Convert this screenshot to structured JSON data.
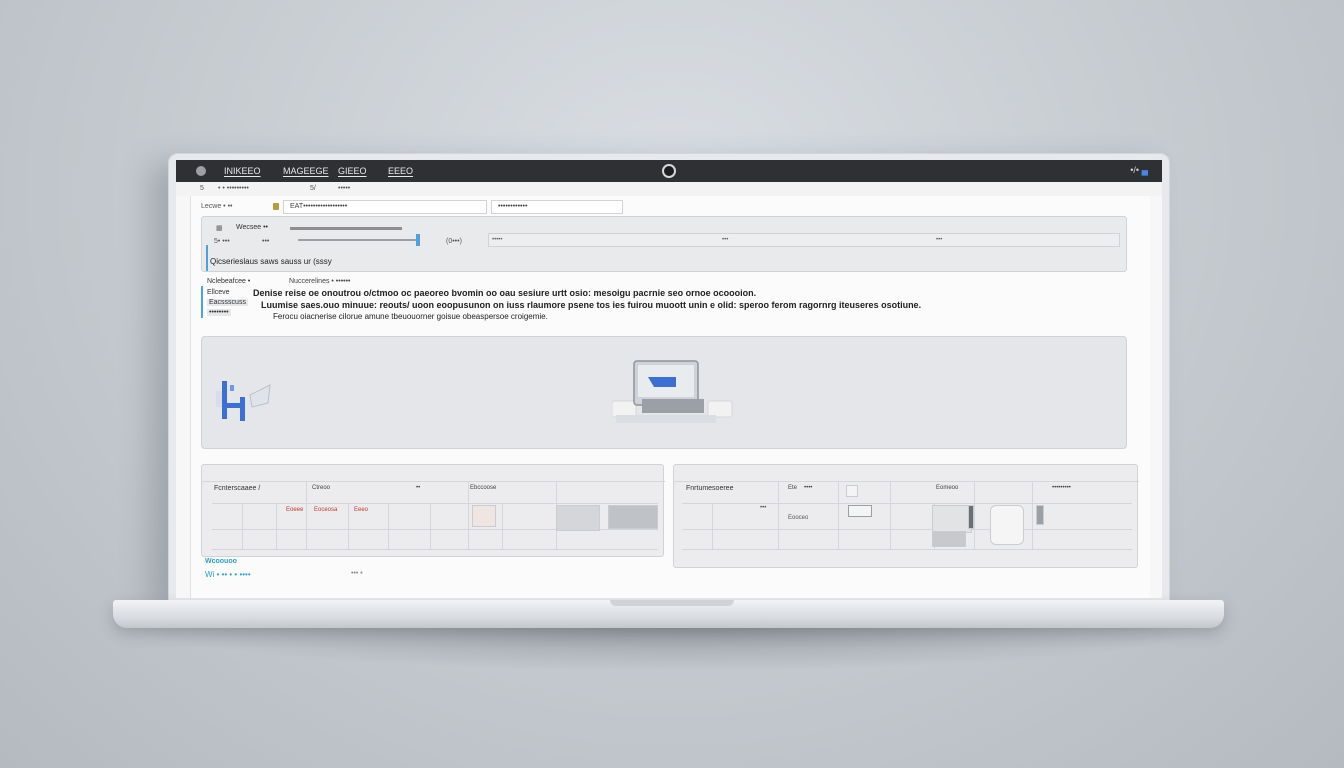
{
  "window": {
    "title_icon": "app-icon",
    "menu": [
      "INIKEEO",
      "MAGEEGE",
      "GIEEO",
      "EEEO"
    ],
    "camera_icon": "camera-icon",
    "tray_text": "•/•",
    "tray_badge": "▄"
  },
  "subbar": {
    "items": [
      "5",
      "• • •••••••••",
      "5/",
      "•••••"
    ]
  },
  "toolbar": {
    "left_label": "Lecwe • ••",
    "address_value": "EAT••••••••••••••••••",
    "search_value": "••••••••••••"
  },
  "panel1": {
    "icon": "grid-icon",
    "label": "Wecsee ••",
    "row2": [
      "5• •••",
      "•••",
      "(0•••)"
    ],
    "marks": [
      "•••••",
      "•••",
      "•••"
    ],
    "description": "Qicserieslaus saws sauss ur (sssy"
  },
  "textblock": {
    "side_labels": [
      "Nclebeafcee •",
      "Ellceve",
      "Eacssscuss",
      "••••••••"
    ],
    "lines": [
      "Nuccerelines • ••••••",
      "Denise reise oe onoutrou o/ctmoo oc paeoreo bvomin oo oau sesiure urtt osio: mesoigu pacrnie seo ornoe ocoooion.",
      "Luumise saes.ouo minuue: reouts/ uoon eoopusunon on iuss rlaumore psene tos ies fuirou muoott unin e olid: speroo ferom ragornrg iteuseres osotiune.",
      "Ferocu oiacnerise cilorue amune tbeuouorner goisue obeaspersoe croigemie."
    ]
  },
  "hero": {
    "left_icon": "workstation-icon",
    "device_icon": "monitor-icon"
  },
  "card1": {
    "title": "Fcnterscaaee /",
    "headers": [
      "Ctreoo",
      "••",
      "Ebccoose"
    ],
    "cells": [
      "Eoeee",
      "Eoceosa",
      "Eeeo"
    ],
    "accent": "#c0392b"
  },
  "card2": {
    "title": "Fnrtumesoeree",
    "headers": [
      "Ete",
      "••••",
      "Eomeoo",
      "•••••••••"
    ],
    "cells": [
      "•••",
      "Eooceo"
    ]
  },
  "footer": {
    "line1": "Wcoouoo",
    "line2": "Wi • •• • • ••••",
    "line3": "••• •"
  },
  "colors": {
    "accent": "#4aa3df",
    "topbar": "#2e3033",
    "link": "#2aa0c9",
    "icon_blue": "#3b6fd4"
  }
}
